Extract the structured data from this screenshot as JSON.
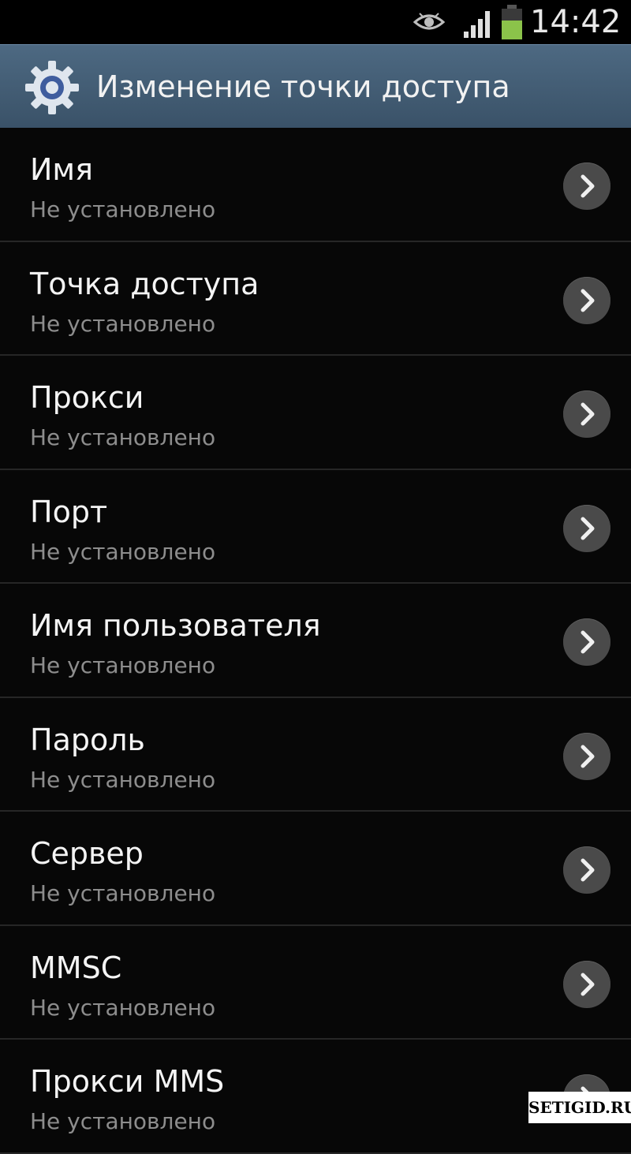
{
  "status_bar": {
    "time": "14:42",
    "battery_color": "#8bc34a",
    "icons": [
      "eye-icon",
      "signal-icon",
      "battery-icon"
    ]
  },
  "action_bar": {
    "title": "Изменение точки доступа",
    "icon": "gear-icon",
    "color": "#4a6580"
  },
  "items": [
    {
      "title": "Имя",
      "subtitle": "Не установлено"
    },
    {
      "title": "Точка доступа",
      "subtitle": "Не установлено"
    },
    {
      "title": "Прокси",
      "subtitle": "Не установлено"
    },
    {
      "title": "Порт",
      "subtitle": "Не установлено"
    },
    {
      "title": "Имя пользователя",
      "subtitle": "Не установлено"
    },
    {
      "title": "Пароль",
      "subtitle": "Не установлено"
    },
    {
      "title": "Сервер",
      "subtitle": "Не установлено"
    },
    {
      "title": "MMSC",
      "subtitle": "Не установлено"
    },
    {
      "title": "Прокси MMS",
      "subtitle": "Не установлено"
    }
  ],
  "item_icon": "chevron-right-icon",
  "watermark": "SETIGID.RU"
}
